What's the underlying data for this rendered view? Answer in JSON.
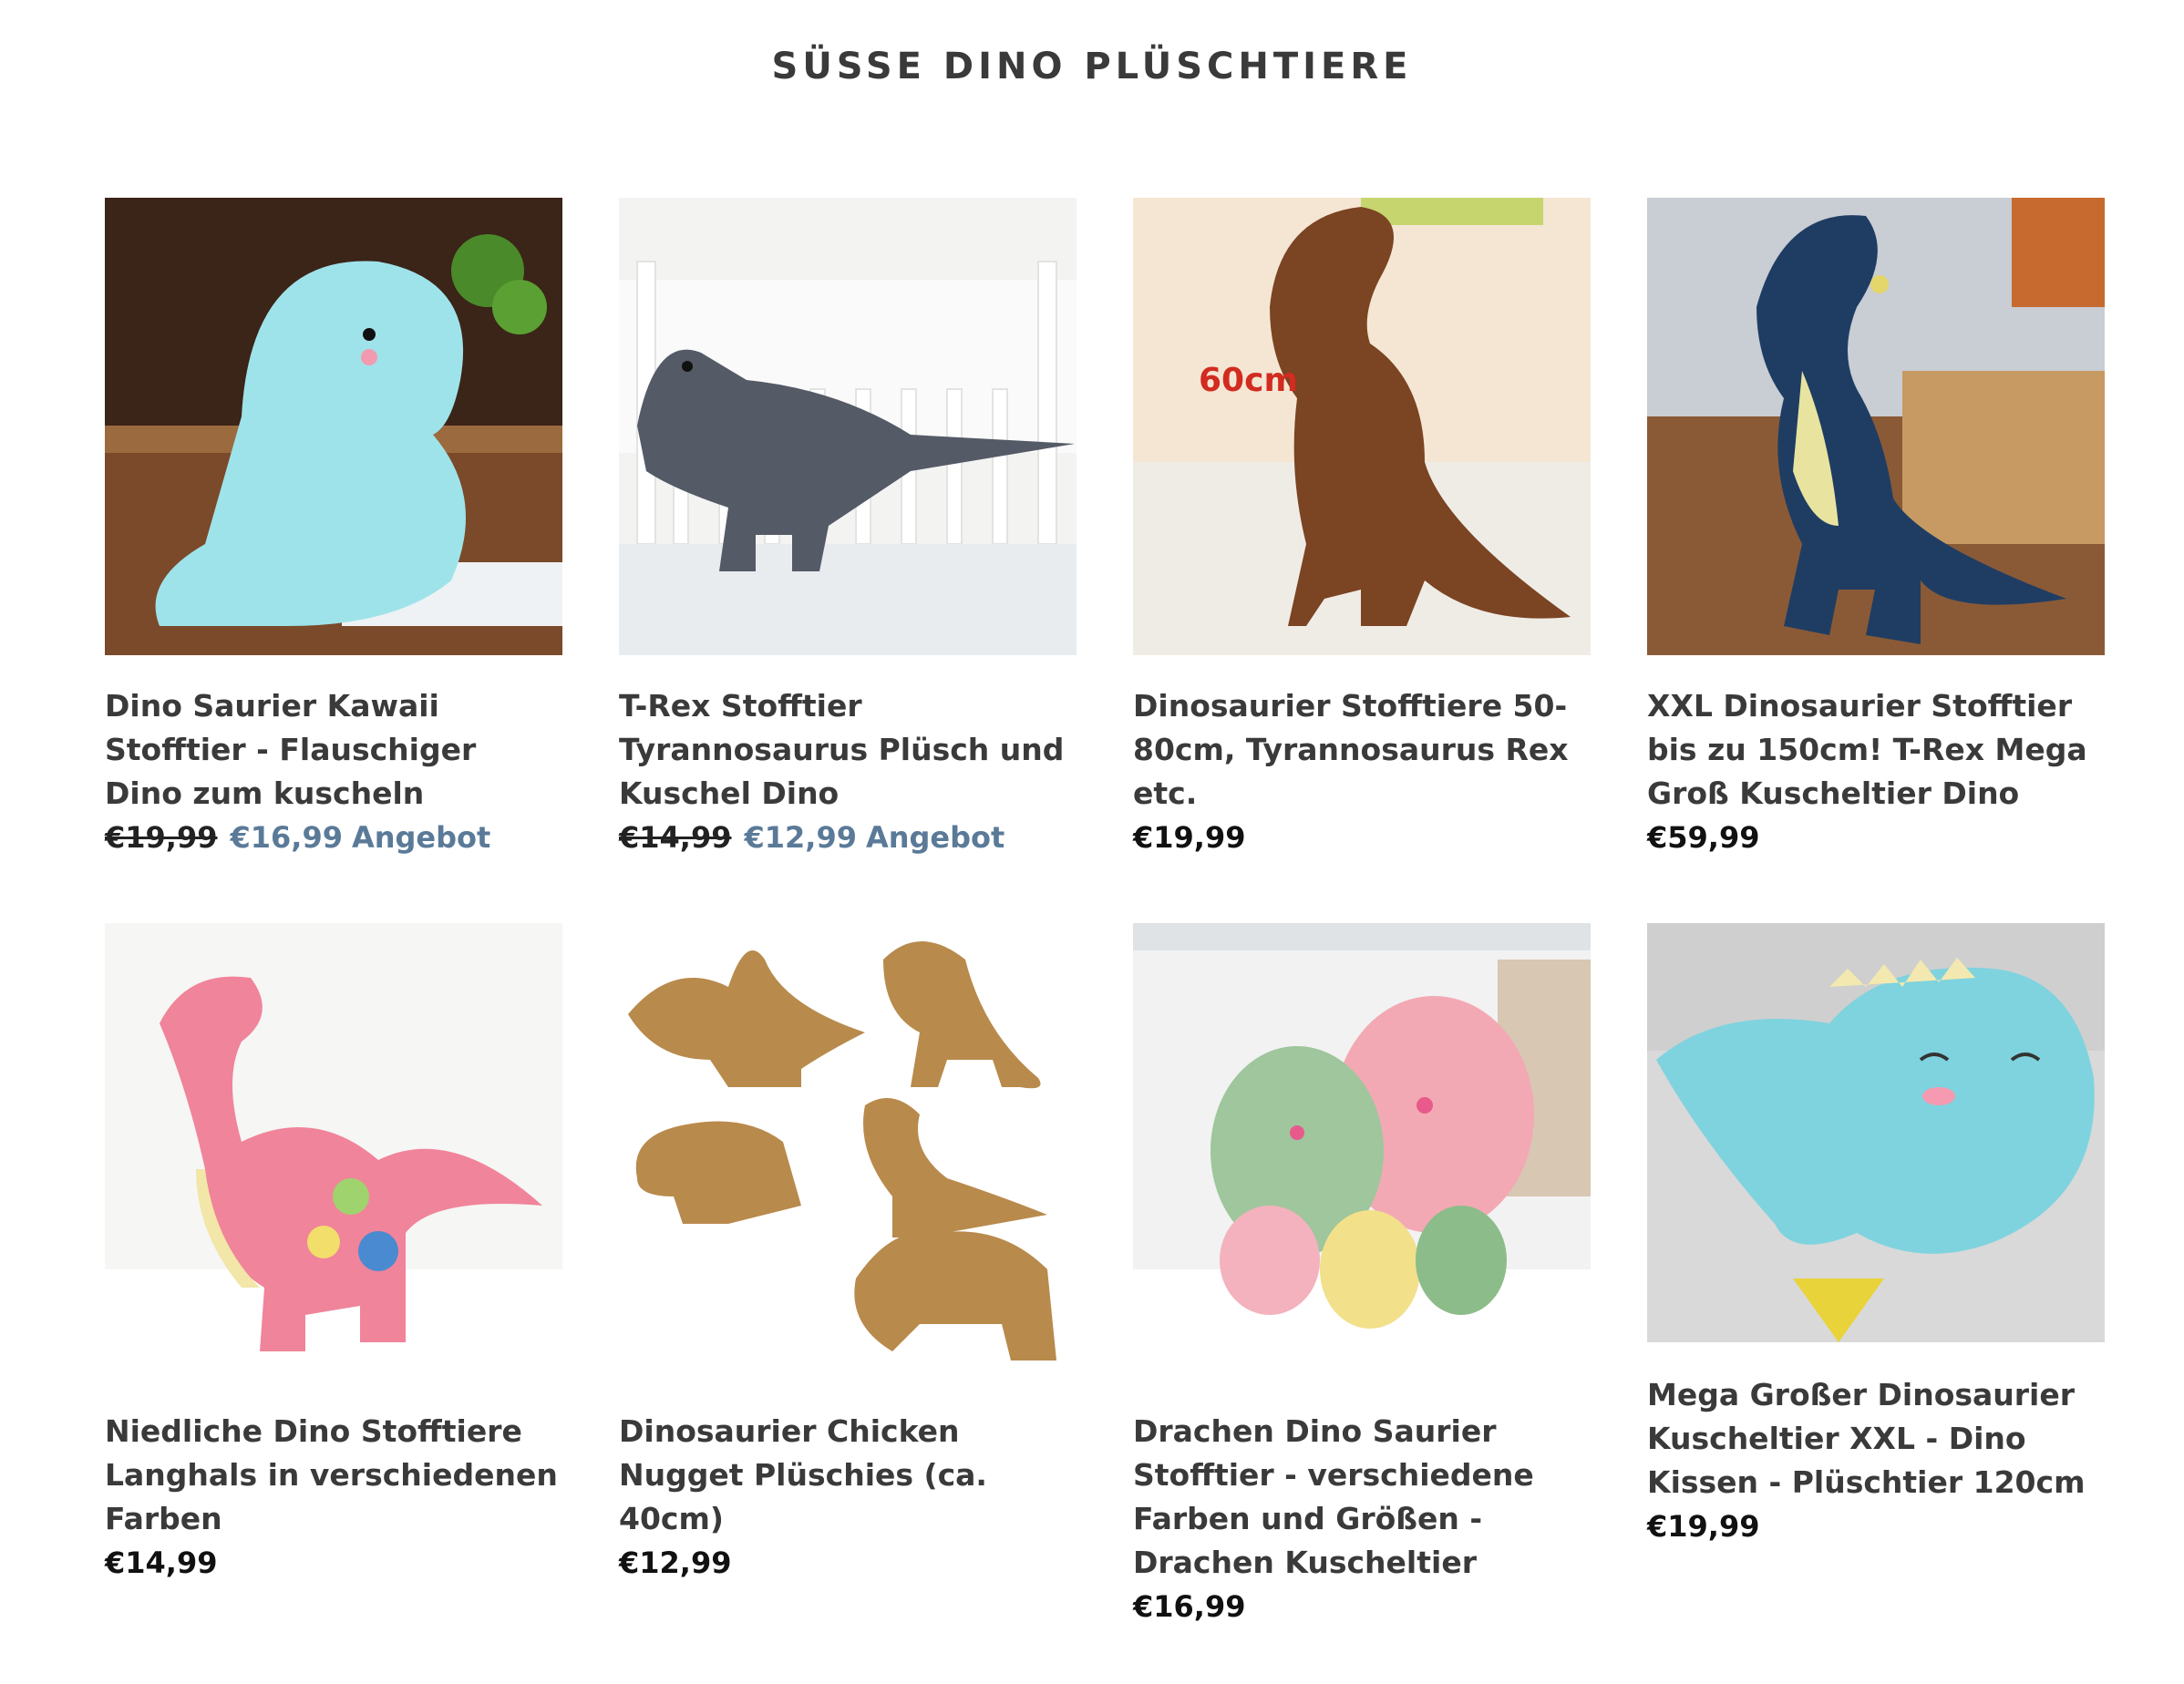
{
  "section": {
    "title": "SÜSSE DINO PLÜSCHTIERE"
  },
  "products": [
    {
      "title": "Dino Saurier Kawaii Stofftier - Flauschiger Dino zum kuscheln",
      "price_old": "€19,99",
      "price": "€16,99",
      "sale_label": "Angebot",
      "image": "light-blue-kawaii-dino-plush"
    },
    {
      "title": "T-Rex Stofftier Tyrannosaurus Plüsch und Kuschel Dino",
      "price_old": "€14,99",
      "price": "€12,99",
      "sale_label": "Angebot",
      "image": "grey-trex-plush"
    },
    {
      "title": "Dinosaurier Stofftiere 50-80cm, Tyrannosaurus Rex etc.",
      "price": "€19,99",
      "image": "brown-trex-plush",
      "image_label": "60cm"
    },
    {
      "title": "XXL Dinosaurier Stofftier bis zu 150cm! T-Rex Mega Groß Kuscheltier Dino",
      "price": "€59,99",
      "image": "blue-trex-plush"
    },
    {
      "title": "Niedliche Dino Stofftiere Langhals in verschiedenen Farben",
      "price": "€14,99",
      "image": "pink-longneck-dino-plush"
    },
    {
      "title": "Dinosaurier Chicken Nugget Plüschies (ca. 40cm)",
      "price": "€12,99",
      "image": "chicken-nugget-dino-plushies"
    },
    {
      "title": "Drachen Dino Saurier Stofftier - verschiedene Farben und Größen - Drachen Kuscheltier",
      "price": "€16,99",
      "image": "dragon-dino-plush-family"
    },
    {
      "title": "Mega Großer Dinosaurier Kuscheltier XXL - Dino Kissen - Plüschtier 120cm",
      "price": "€19,99",
      "image": "blue-lying-dino-pillow"
    }
  ],
  "colors": {
    "heading": "#3a3a3a",
    "sale": "#5a7a98",
    "price": "#111111"
  }
}
